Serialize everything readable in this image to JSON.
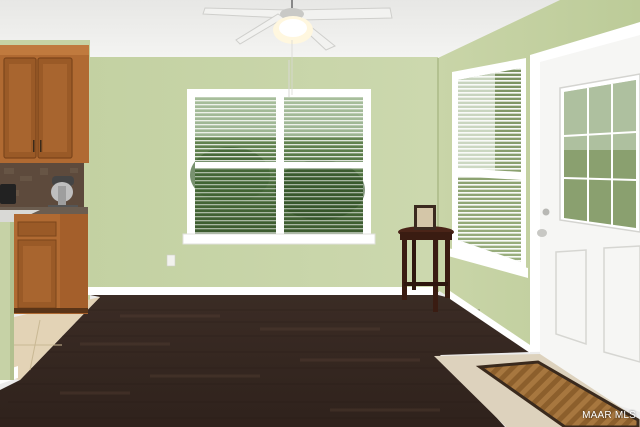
{
  "photo": {
    "subject": "interior-dining-nook",
    "colors": {
      "wall": "#c8d5a7",
      "wall_shadow": "#b7c497",
      "ceiling": "#eeeeec",
      "floor": "#3a2a22",
      "floor_light": "#4a362b",
      "cabinet": "#b06a32",
      "cabinet_dark": "#8a4e22",
      "trim": "#ffffff",
      "door": "#f6f6f4",
      "mat": "#a7773f",
      "tile": "#e3d3b6"
    }
  },
  "watermark": {
    "text": "MAAR MLS"
  }
}
